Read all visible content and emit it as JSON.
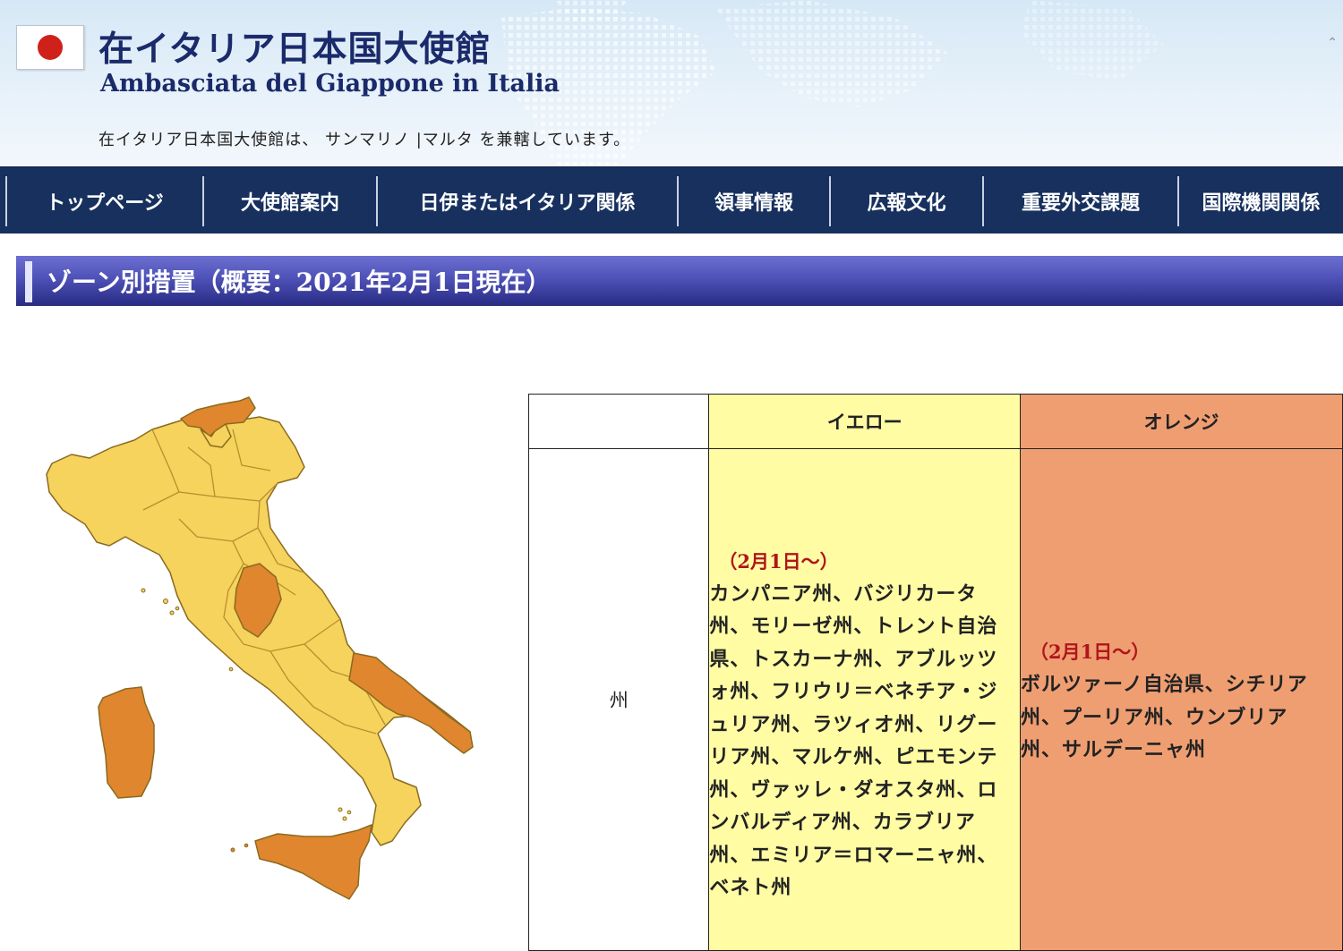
{
  "header": {
    "title_ja": "在イタリア日本国大使館",
    "title_it": "Ambasciata del Giappone in Italia",
    "subtext": "在イタリア日本国大使館は、 サンマリノ |マルタ を兼轄しています。",
    "flag_icon": "japan-flag-icon",
    "colors": {
      "title": "#1a2a6a",
      "header_bg": "#d6e8f6"
    }
  },
  "nav": {
    "items": [
      {
        "label": "トップページ"
      },
      {
        "label": "大使館案内"
      },
      {
        "label": "日伊またはイタリア関係"
      },
      {
        "label": "領事情報"
      },
      {
        "label": "広報文化"
      },
      {
        "label": "重要外交課題"
      },
      {
        "label": "国際機関関係"
      }
    ],
    "colors": {
      "bg": "#17305e",
      "text": "#ffffff"
    }
  },
  "section": {
    "title": "ゾーン別措置（概要：2021年2月1日現在）",
    "colors": {
      "bar": "#4f52b8"
    }
  },
  "map": {
    "zones_shown": {
      "yellow": "#f5d35c",
      "orange": "#e0862e"
    }
  },
  "table": {
    "headers": {
      "blank": "",
      "yellow": "イエロー",
      "orange": "オレンジ"
    },
    "row_label": "州",
    "yellow": {
      "date": "（2月1日〜）",
      "regions": "カンパニア州、バジリカータ州、モリーゼ州、トレント自治県、トスカーナ州、アブルッツォ州、フリウリ＝ベネチア・ジュリア州、ラツィオ州、リグーリア州、マルケ州、ピエモンテ州、ヴァッレ・ダオスタ州、ロンバルディア州、カラブリア州、エミリア＝ロマーニャ州、ベネト州"
    },
    "orange": {
      "date": "（2月1日〜）",
      "regions": "ボルツァーノ自治県、シチリア州、プーリア州、ウンブリア州、サルデーニャ州"
    },
    "colors": {
      "yellow": "#fffca4",
      "orange": "#ef9e72",
      "date": "#b0151b"
    }
  }
}
